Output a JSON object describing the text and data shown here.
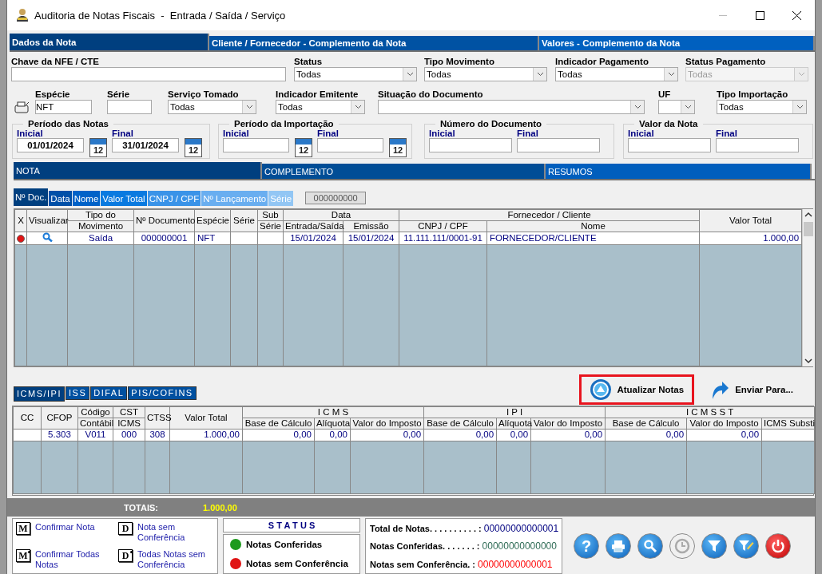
{
  "window": {
    "title": "Auditoria de Notas Fiscais  -  Entrada / Saída / Serviço"
  },
  "top_tabs": [
    {
      "label": "Dados da Nota",
      "selected": true
    },
    {
      "label": "Cliente / Fornecedor - Complemento da Nota",
      "selected": false
    },
    {
      "label": "Valores - Complemento da Nota",
      "selected": false
    }
  ],
  "filters_row1": [
    {
      "kind": "text",
      "label": "Chave da NFE / CTE",
      "disabled": false
    },
    {
      "kind": "select",
      "label": "Status",
      "value": "Todas",
      "disabled": false
    },
    {
      "kind": "select",
      "label": "Tipo Movimento",
      "value": "Todas",
      "disabled": false
    },
    {
      "kind": "select",
      "label": "Indicador Pagamento",
      "value": "Todas",
      "disabled": false
    },
    {
      "kind": "select",
      "label": "Status Pagamento",
      "value": "Todas",
      "disabled": true
    }
  ],
  "filters_row2": [
    {
      "kind": "text",
      "label": "Espécie",
      "value": "NFT",
      "disabled": false
    },
    {
      "kind": "text",
      "label": "Série",
      "disabled": false
    },
    {
      "kind": "select",
      "label": "Serviço Tomado",
      "value": "Todas",
      "disabled": false
    },
    {
      "kind": "select",
      "label": "Indicador Emitente",
      "value": "Todas",
      "disabled": false
    },
    {
      "kind": "select",
      "label": "Situação do Documento",
      "disabled": false
    },
    {
      "kind": "select",
      "label": "UF",
      "disabled": false
    },
    {
      "kind": "select",
      "label": "Tipo Importação",
      "value": "Todas",
      "disabled": false
    }
  ],
  "ranges": [
    {
      "kind": "date",
      "title": "Período das Notas",
      "from_label": "Inicial",
      "from_value": "01/01/2024",
      "from_calendar_label": "12",
      "to_label": "Final",
      "to_value": "31/01/2024",
      "to_calendar_label": "12"
    },
    {
      "kind": "date",
      "title": "Período da Importação",
      "from_label": "Inicial",
      "from_calendar_label": "12",
      "to_label": "Final",
      "to_calendar_label": "12"
    },
    {
      "kind": "plain",
      "title": "Número do Documento",
      "from_label": "Inicial",
      "to_label": "Final"
    },
    {
      "kind": "plain",
      "title": "Valor da Nota",
      "from_label": "Inicial",
      "to_label": "Final"
    }
  ],
  "section_tabs": [
    {
      "label": "NOTA",
      "selected": true
    },
    {
      "label": "COMPLEMENTO",
      "selected": false
    },
    {
      "label": "RESUMOS",
      "selected": false
    }
  ],
  "sort_tabs": [
    {
      "label": "Nº Doc.",
      "selected": true
    },
    {
      "label": "Data",
      "selected": false
    },
    {
      "label": "Nome",
      "selected": false
    },
    {
      "label": "Valor Total",
      "selected": false
    },
    {
      "label": "CNPJ / CPF",
      "selected": false
    },
    {
      "label": "Nº Lançamento",
      "selected": false
    },
    {
      "label": "Série",
      "selected": false
    }
  ],
  "sort_search": {
    "value": "000000000"
  },
  "notes_table": {
    "header_rows": [
      [
        {
          "label": "X",
          "rowspan": 2
        },
        {
          "label": "Visualizar",
          "rowspan": 2
        },
        {
          "label": "Tipo do"
        },
        {
          "label": "Nº Documento",
          "rowspan": 2
        },
        {
          "label": "Espécie",
          "rowspan": 2
        },
        {
          "label": "Série",
          "rowspan": 2
        },
        {
          "label": "Sub"
        },
        {
          "label": "Data",
          "colspan": 2
        },
        {
          "label": "Fornecedor / Cliente",
          "colspan": 2
        },
        {
          "label": "Valor Total",
          "rowspan": 2
        }
      ],
      [
        {
          "label": "Movimento"
        },
        {
          "label": "Série"
        },
        {
          "label": "Entrada/Saída"
        },
        {
          "label": "Emissão"
        },
        {
          "label": "CNPJ / CPF"
        },
        {
          "label": "Nome"
        }
      ]
    ],
    "rows": [
      {
        "conferida": false,
        "tipo": "Saída",
        "numero": "000000001",
        "especie": "NFT",
        "entrada_saida": "15/01/2024",
        "emissao": "15/01/2024",
        "cnpj_cpf": "11.111.111/0001-91",
        "nome": "FORNECEDOR/CLIENTE",
        "valor_total": "1.000,00"
      }
    ]
  },
  "tax_tabs": [
    {
      "label": "ICMS/IPI",
      "selected": true
    },
    {
      "label": "ISS",
      "selected": false
    },
    {
      "label": "DIFAL",
      "selected": false
    },
    {
      "label": "PIS/COFINS",
      "selected": false
    }
  ],
  "actions": [
    {
      "kind": "refresh",
      "label": "Atualizar Notas",
      "highlighted": true
    },
    {
      "kind": "send",
      "label": "Enviar Para...",
      "highlighted": false
    }
  ],
  "tax_table": {
    "header_rows": [
      [
        {
          "label": "CC",
          "rowspan": 2
        },
        {
          "label": "CFOP",
          "rowspan": 2
        },
        {
          "label": "Código"
        },
        {
          "label": "CST"
        },
        {
          "label": "CTSS",
          "rowspan": 2
        },
        {
          "label": "Valor Total",
          "rowspan": 2
        },
        {
          "label": "I C M S",
          "colspan": 3
        },
        {
          "label": "I P I",
          "colspan": 3
        },
        {
          "label": "I C M S   S T",
          "colspan": 3
        }
      ],
      [
        {
          "label": "Contábil"
        },
        {
          "label": "ICMS"
        },
        {
          "label": "Base de Cálculo"
        },
        {
          "label": "Alíquota"
        },
        {
          "label": "Valor do Imposto"
        },
        {
          "label": "Base de Cálculo"
        },
        {
          "label": "Alíquota"
        },
        {
          "label": "Valor do Imposto"
        },
        {
          "label": "Base de Cálculo"
        },
        {
          "label": "Valor do Imposto"
        },
        {
          "label": "ICMS Substi"
        }
      ]
    ],
    "rows": [
      {
        "cfop": "5.303",
        "codigo_contabil": "V011",
        "cst_icms": "000",
        "ctss": "308",
        "valor_total": "1.000,00",
        "icms_base": "0,00",
        "icms_aliquota": "0,00",
        "icms_valor": "0,00",
        "ipi_base": "0,00",
        "ipi_aliquota": "0,00",
        "ipi_valor": "0,00",
        "st_base": "0,00",
        "st_valor": "0,00"
      }
    ]
  },
  "totals": {
    "label": "TOTAIS:",
    "value": "1.000,00"
  },
  "legend": [
    {
      "key": "M",
      "kind": "single",
      "label": "Confirmar Nota"
    },
    {
      "key": "D",
      "kind": "single",
      "label": "Nota sem Conferência"
    },
    {
      "key": "M",
      "kind": "all",
      "label": "Confirmar Todas Notas"
    },
    {
      "key": "D",
      "kind": "all",
      "label": "Todas Notas sem Conferência"
    }
  ],
  "status_legend": {
    "title": "S T A T U S",
    "items": [
      {
        "label": "Notas Conferidas",
        "color": "#1e9a1e"
      },
      {
        "label": "Notas sem Conferência",
        "color": "#e01414"
      }
    ]
  },
  "summary": [
    {
      "label": "Total de Notas. . . . . . . . . . :",
      "value": "00000000000001",
      "color": "#000080"
    },
    {
      "label": "Notas Conferidas. . . . . . . :",
      "value": "00000000000000",
      "color": "#2e6b55"
    },
    {
      "label": "Notas sem Conferência. :",
      "value": "00000000000001",
      "color": "#ff0000"
    }
  ],
  "toolbar": [
    {
      "kind": "help",
      "glyph": "?",
      "disabled": false
    },
    {
      "kind": "print",
      "disabled": false
    },
    {
      "kind": "search",
      "disabled": false
    },
    {
      "kind": "clock",
      "disabled": true
    },
    {
      "kind": "filter",
      "disabled": false
    },
    {
      "kind": "filter-edit",
      "disabled": false
    },
    {
      "kind": "power",
      "disabled": false
    }
  ]
}
